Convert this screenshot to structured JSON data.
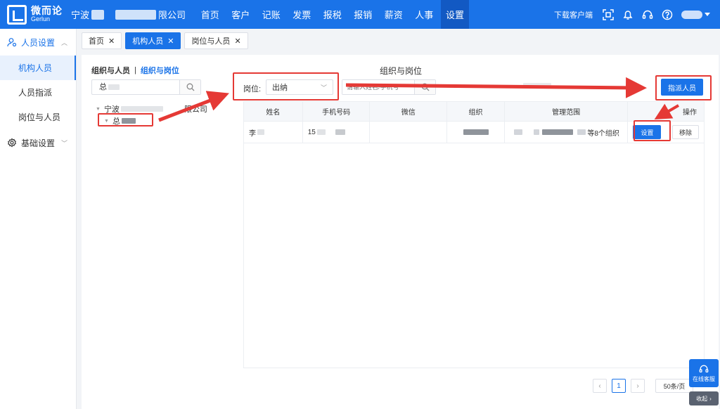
{
  "header": {
    "logo_cn": "微而论",
    "logo_en": "Gerlun",
    "company_prefix": "宁波",
    "company_suffix": "限公司",
    "nav": [
      "首页",
      "客户",
      "记账",
      "发票",
      "报税",
      "报销",
      "薪资",
      "人事",
      "设置"
    ],
    "active_nav": "设置",
    "download": "下载客户端"
  },
  "sidebar": {
    "group1": "人员设置",
    "items": [
      "机构人员",
      "人员指派",
      "岗位与人员"
    ],
    "active_item": "机构人员",
    "group2": "基础设置"
  },
  "tabs": [
    {
      "label": "首页"
    },
    {
      "label": "机构人员"
    },
    {
      "label": "岗位与人员"
    }
  ],
  "left_panel": {
    "subnav_active": "组织与人员",
    "subnav_link": "组织与岗位",
    "search_value": "总",
    "tree_root": "宁波",
    "tree_root_suffix": "限公司",
    "tree_child": "总"
  },
  "main": {
    "title": "组织与岗位",
    "position_label": "岗位:",
    "position_value": "出纳",
    "search_placeholder": "请输入姓名/手机号",
    "assign_button": "指派人员"
  },
  "table": {
    "columns": [
      "姓名",
      "手机号码",
      "微信",
      "组织",
      "管理范围",
      "操作"
    ],
    "rows": [
      {
        "name": "李",
        "phone": "15",
        "wechat": "",
        "org": "",
        "scope_suffix": "等8个组织",
        "set": "设置",
        "remove": "移除"
      }
    ]
  },
  "pagination": {
    "current": "1",
    "page_size": "50条/页"
  },
  "float": {
    "service": "在线客服",
    "collapse": "收起"
  },
  "colors": {
    "primary": "#1a73e8",
    "annotation": "#e53935"
  }
}
